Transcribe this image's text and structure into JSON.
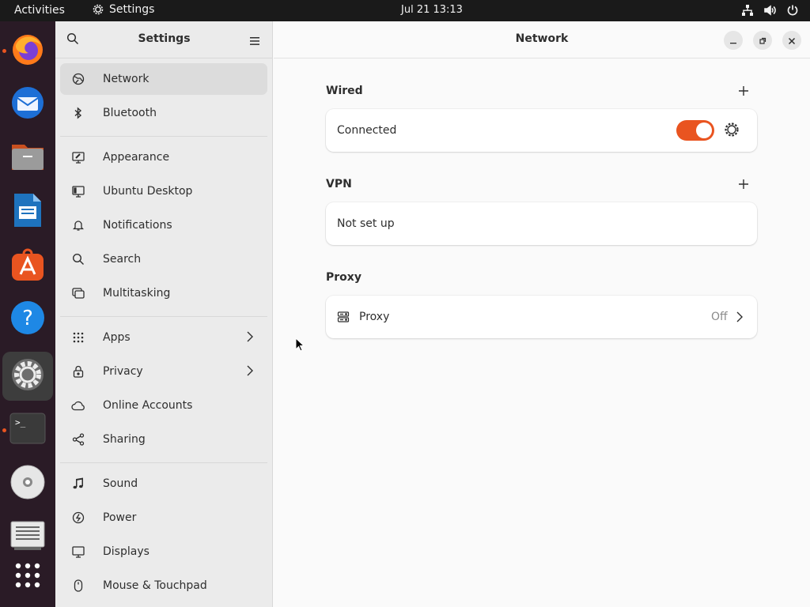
{
  "topbar": {
    "activities": "Activities",
    "app_name": "Settings",
    "clock": "Jul 21  13:13",
    "tray_icons": [
      "network-wired-icon",
      "volume-icon",
      "power-icon"
    ]
  },
  "dock": {
    "items": [
      {
        "name": "firefox",
        "running": true
      },
      {
        "name": "thunderbird",
        "running": false
      },
      {
        "name": "files",
        "running": false
      },
      {
        "name": "libreoffice-writer",
        "running": false
      },
      {
        "name": "app-center",
        "running": false
      },
      {
        "name": "help",
        "running": false
      },
      {
        "name": "settings",
        "running": true,
        "active": true
      },
      {
        "name": "terminal",
        "running": true
      },
      {
        "name": "disc",
        "running": false
      },
      {
        "name": "text-editor",
        "running": false
      },
      {
        "name": "show-apps",
        "running": false
      }
    ]
  },
  "sidebar": {
    "title": "Settings",
    "items": [
      {
        "label": "Network",
        "icon": "network-icon",
        "selected": true
      },
      {
        "label": "Bluetooth",
        "icon": "bluetooth-icon"
      },
      {
        "label": "Appearance",
        "icon": "appearance-icon"
      },
      {
        "label": "Ubuntu Desktop",
        "icon": "ubuntu-desktop-icon"
      },
      {
        "label": "Notifications",
        "icon": "bell-icon"
      },
      {
        "label": "Search",
        "icon": "search-icon"
      },
      {
        "label": "Multitasking",
        "icon": "multitasking-icon"
      },
      {
        "label": "Apps",
        "icon": "apps-grid-icon",
        "has_submenu": true
      },
      {
        "label": "Privacy",
        "icon": "lock-icon",
        "has_submenu": true
      },
      {
        "label": "Online Accounts",
        "icon": "cloud-icon"
      },
      {
        "label": "Sharing",
        "icon": "share-icon"
      },
      {
        "label": "Sound",
        "icon": "music-note-icon"
      },
      {
        "label": "Power",
        "icon": "power-icon"
      },
      {
        "label": "Displays",
        "icon": "display-icon"
      },
      {
        "label": "Mouse & Touchpad",
        "icon": "mouse-icon"
      }
    ]
  },
  "main": {
    "title": "Network",
    "wired": {
      "title": "Wired",
      "status": "Connected",
      "enabled": true
    },
    "vpn": {
      "title": "VPN",
      "status": "Not set up"
    },
    "proxy": {
      "title": "Proxy",
      "label": "Proxy",
      "value": "Off"
    }
  },
  "colors": {
    "accent": "#e95420",
    "topbar": "#1a1a1a",
    "dock": "#2a1b26",
    "sidebar_bg": "#ebebeb",
    "content_bg": "#fafafa"
  }
}
